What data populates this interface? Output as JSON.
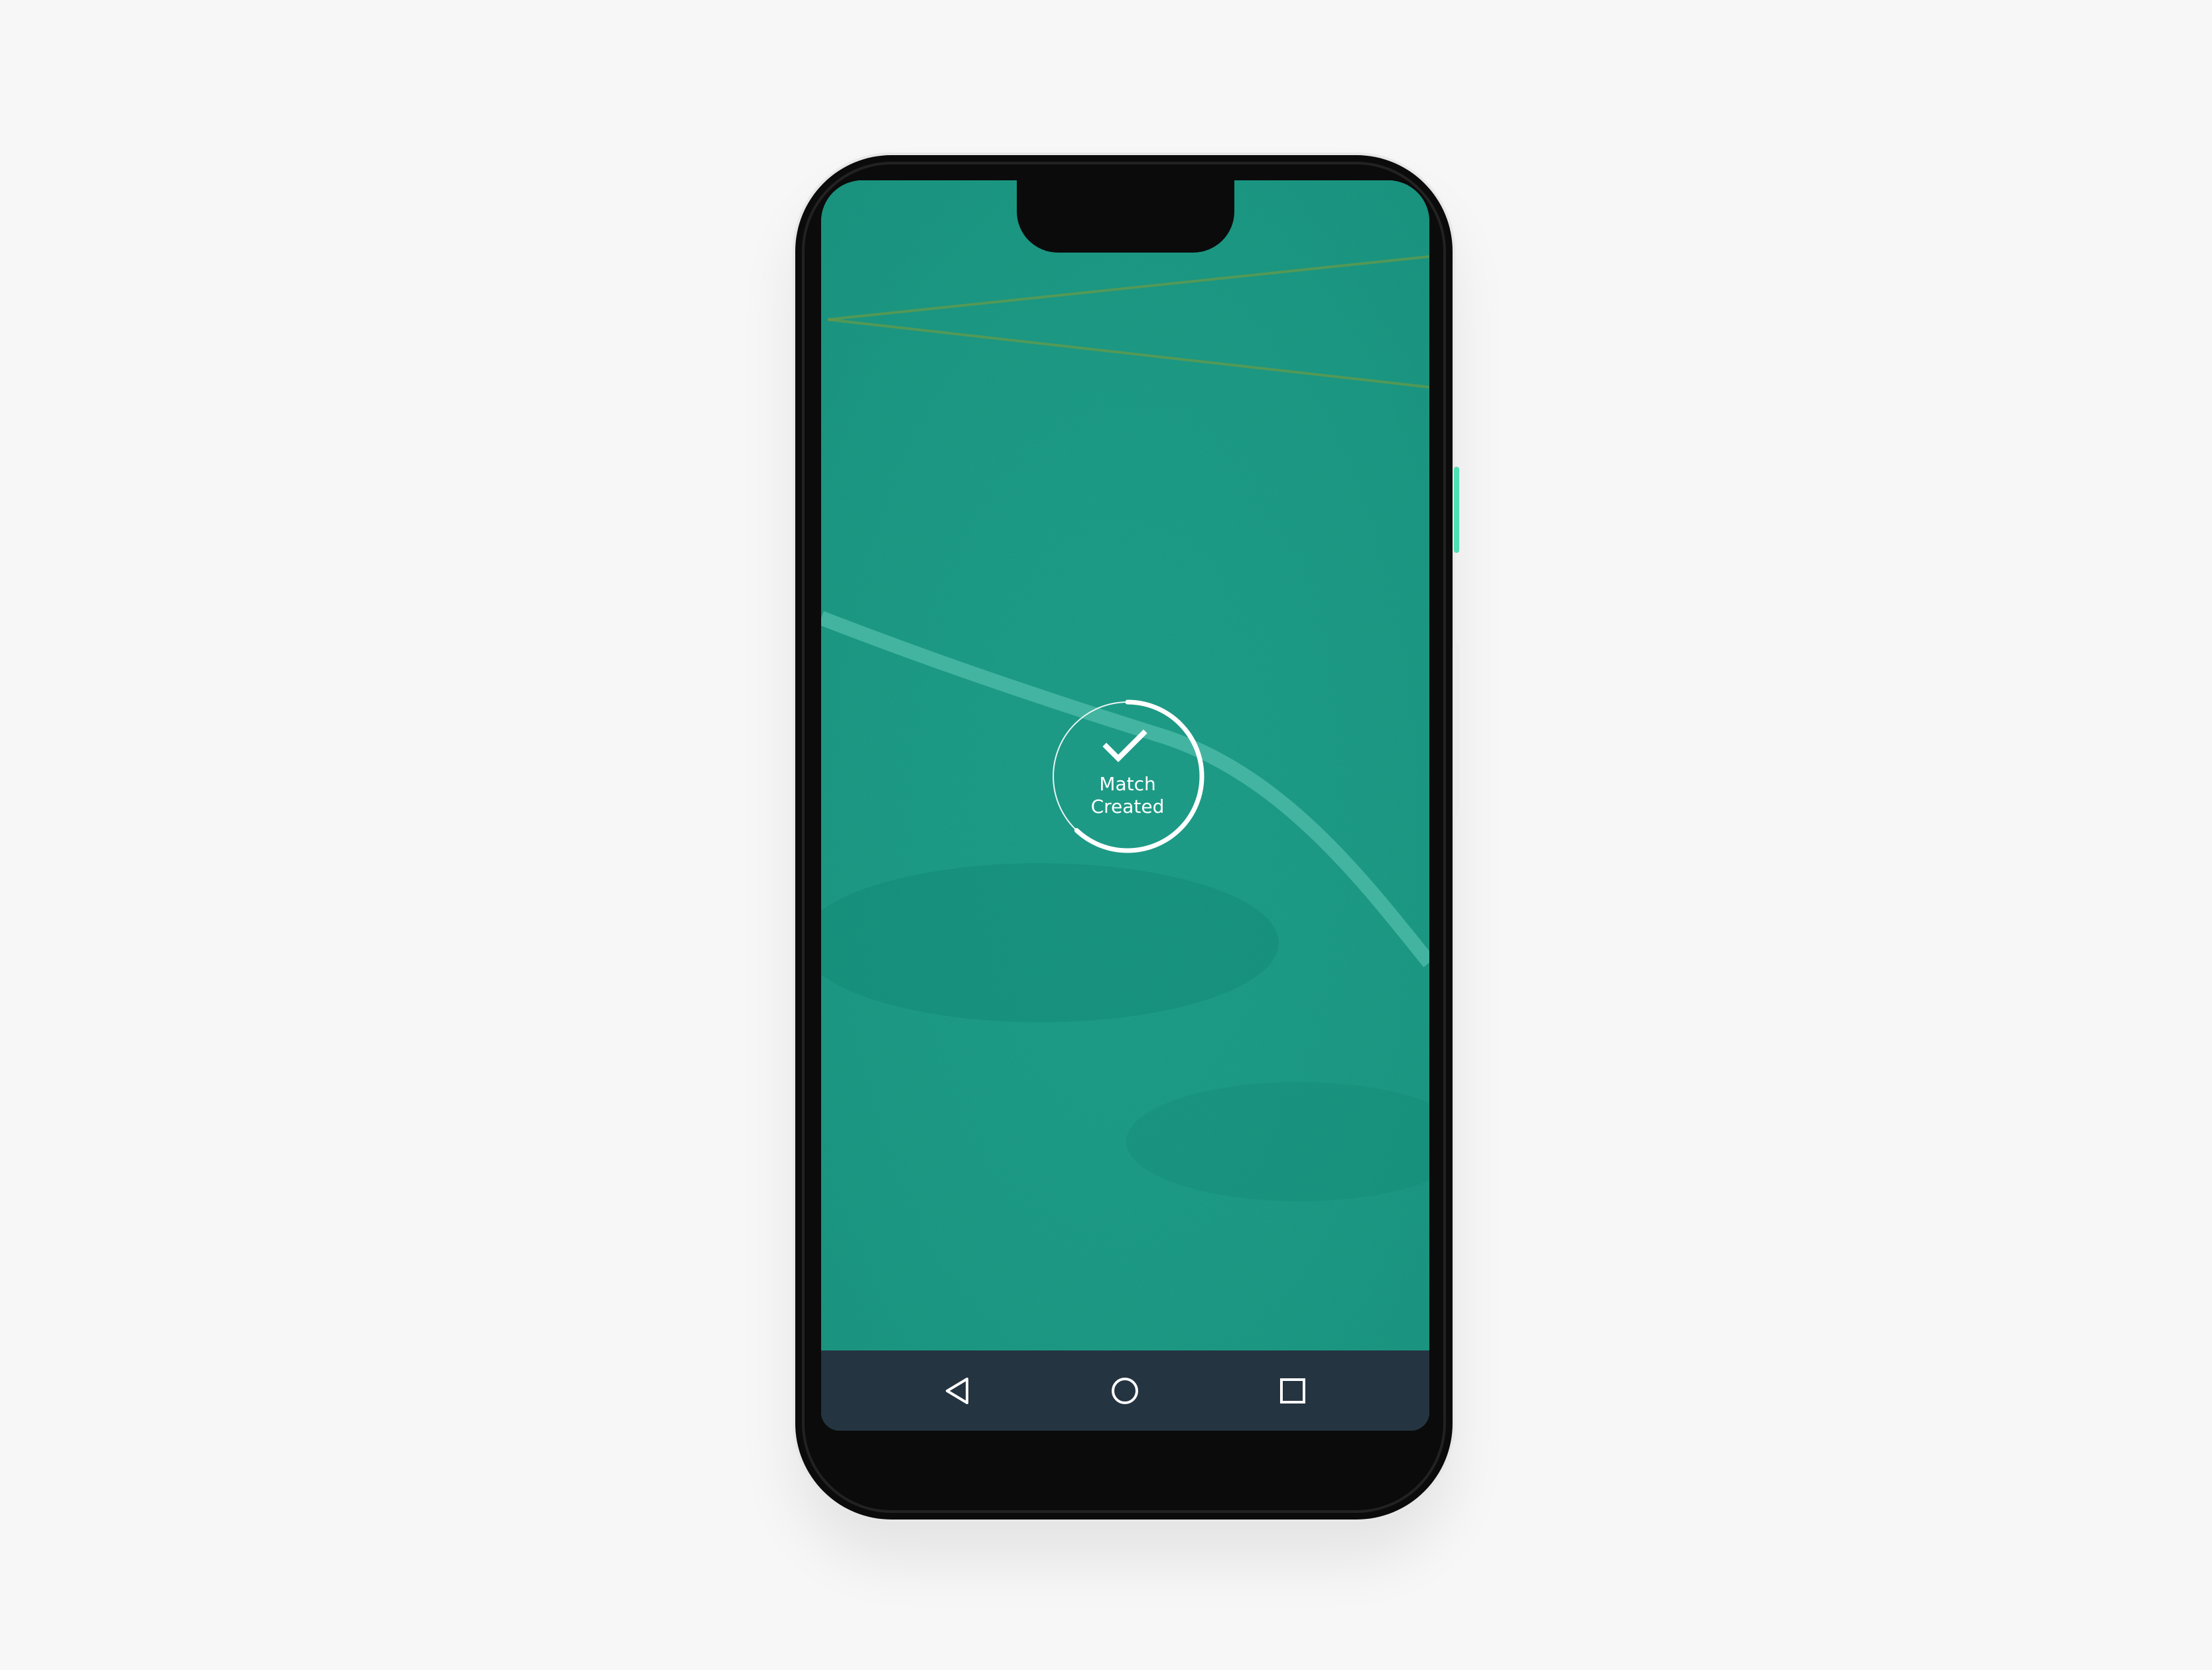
{
  "status": {
    "line1": "Match",
    "line2": "Created",
    "icon": "check-icon",
    "progress": 0.62
  },
  "navigation": {
    "back": "back-triangle-icon",
    "home": "home-circle-icon",
    "recents": "recents-square-icon"
  },
  "colors": {
    "field": "#16957f",
    "nav_bar": "#253441",
    "accent_button": "#4fe0b4",
    "foreground": "#ffffff"
  }
}
